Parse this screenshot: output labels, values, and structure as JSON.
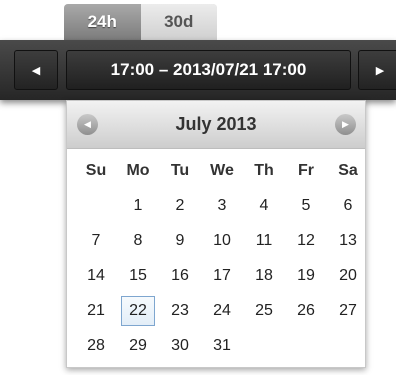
{
  "tabs": [
    {
      "label": "24h",
      "active": true
    },
    {
      "label": "30d",
      "active": false
    }
  ],
  "range": {
    "prev_icon": "triangle-left-icon",
    "next_icon": "triangle-right-icon",
    "label": "17:00 – 2013/07/21 17:00"
  },
  "calendar": {
    "title": "July 2013",
    "weekdays": [
      "Su",
      "Mo",
      "Tu",
      "We",
      "Th",
      "Fr",
      "Sa"
    ],
    "days": [
      "",
      "1",
      "2",
      "3",
      "4",
      "5",
      "6",
      "7",
      "8",
      "9",
      "10",
      "11",
      "12",
      "13",
      "14",
      "15",
      "16",
      "17",
      "18",
      "19",
      "20",
      "21",
      "22",
      "23",
      "24",
      "25",
      "26",
      "27",
      "28",
      "29",
      "30",
      "31"
    ],
    "highlighted_day": "22",
    "highlight_color": "#7ea6cf"
  }
}
